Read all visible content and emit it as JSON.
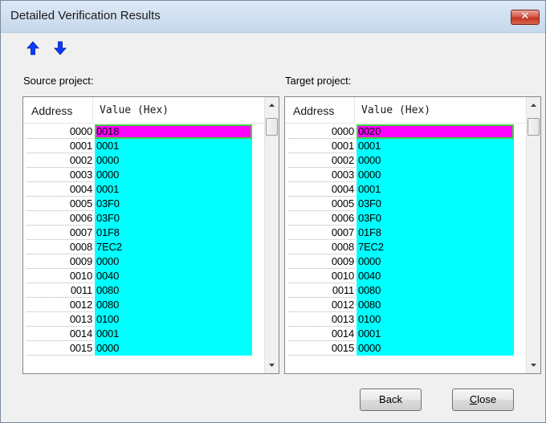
{
  "window": {
    "title": "Detailed Verification Results",
    "close_label": "✕"
  },
  "nav": {
    "up_icon": "blue-up-arrow",
    "down_icon": "blue-down-arrow",
    "arrow_color": "#0a3cff"
  },
  "source": {
    "label": "Source project:",
    "columns": [
      "Address",
      "Value (Hex)"
    ],
    "rows": [
      {
        "addr": "0000",
        "val": "0018",
        "diff": true
      },
      {
        "addr": "0001",
        "val": "0001"
      },
      {
        "addr": "0002",
        "val": "0000"
      },
      {
        "addr": "0003",
        "val": "0000"
      },
      {
        "addr": "0004",
        "val": "0001"
      },
      {
        "addr": "0005",
        "val": "03F0"
      },
      {
        "addr": "0006",
        "val": "03F0"
      },
      {
        "addr": "0007",
        "val": "01F8"
      },
      {
        "addr": "0008",
        "val": "7EC2"
      },
      {
        "addr": "0009",
        "val": "0000"
      },
      {
        "addr": "0010",
        "val": "0040"
      },
      {
        "addr": "0011",
        "val": "0080"
      },
      {
        "addr": "0012",
        "val": "0080"
      },
      {
        "addr": "0013",
        "val": "0100"
      },
      {
        "addr": "0014",
        "val": "0001"
      },
      {
        "addr": "0015",
        "val": "0000"
      }
    ]
  },
  "target": {
    "label": "Target project:",
    "columns": [
      "Address",
      "Value (Hex)"
    ],
    "rows": [
      {
        "addr": "0000",
        "val": "0020",
        "diff": true
      },
      {
        "addr": "0001",
        "val": "0001"
      },
      {
        "addr": "0002",
        "val": "0000"
      },
      {
        "addr": "0003",
        "val": "0000"
      },
      {
        "addr": "0004",
        "val": "0001"
      },
      {
        "addr": "0005",
        "val": "03F0"
      },
      {
        "addr": "0006",
        "val": "03F0"
      },
      {
        "addr": "0007",
        "val": "01F8"
      },
      {
        "addr": "0008",
        "val": "7EC2"
      },
      {
        "addr": "0009",
        "val": "0000"
      },
      {
        "addr": "0010",
        "val": "0040"
      },
      {
        "addr": "0011",
        "val": "0080"
      },
      {
        "addr": "0012",
        "val": "0080"
      },
      {
        "addr": "0013",
        "val": "0100"
      },
      {
        "addr": "0014",
        "val": "0001"
      },
      {
        "addr": "0015",
        "val": "0000"
      }
    ]
  },
  "buttons": {
    "back": "Back",
    "close_first": "C",
    "close_rest": "lose"
  },
  "colors": {
    "match": "#00ffff",
    "mismatch": "#ff00ff",
    "selection_border": "#3cd33c"
  }
}
